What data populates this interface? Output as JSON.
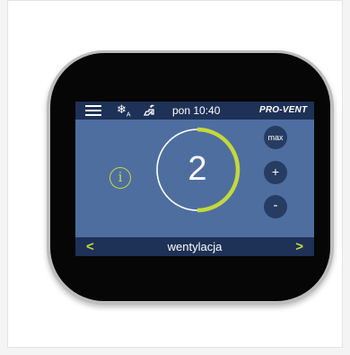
{
  "header": {
    "menu_icon": "hamburger-menu-icon",
    "snow_icon_glyph": "❄",
    "snow_icon_sub": "A",
    "fan_icon": "fan-hand-icon",
    "datetime": "pon 10:40",
    "logo": "PRO-VENT"
  },
  "main": {
    "info_label": "i",
    "level": "2",
    "level_progress": 0.5,
    "buttons": {
      "max": "max",
      "plus": "+",
      "minus": "-"
    }
  },
  "footer": {
    "prev": "<",
    "mode": "wentylacja",
    "next": ">"
  },
  "colors": {
    "screen_bg": "#4e6ea0",
    "bar_bg": "#1e3156",
    "accent": "#c4d93b",
    "button_bg": "#263c62"
  }
}
